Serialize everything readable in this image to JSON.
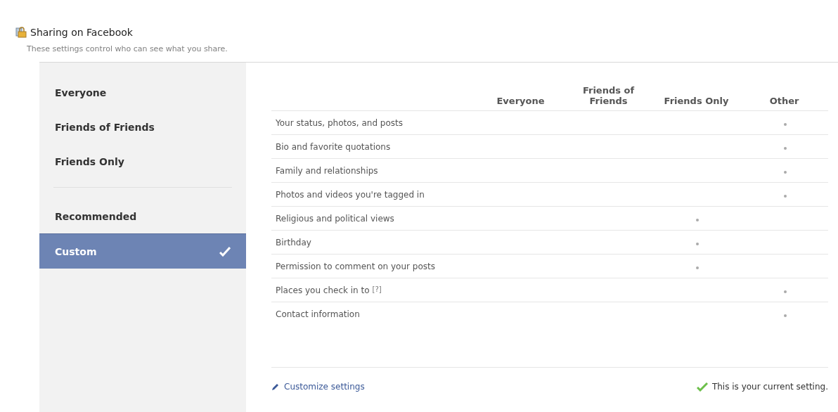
{
  "header": {
    "title": "Sharing on Facebook",
    "subtitle": "These settings control who can see what you share."
  },
  "sidebar": {
    "groups": [
      {
        "items": [
          {
            "label": "Everyone",
            "selected": false
          },
          {
            "label": "Friends of Friends",
            "selected": false
          },
          {
            "label": "Friends Only",
            "selected": false
          }
        ]
      },
      {
        "items": [
          {
            "label": "Recommended",
            "selected": false
          },
          {
            "label": "Custom",
            "selected": true
          }
        ]
      }
    ]
  },
  "table": {
    "columns": [
      "",
      "Everyone",
      "Friends of\nFriends",
      "Friends Only",
      "Other"
    ],
    "rows": [
      {
        "label": "Your status, photos, and posts",
        "cells": [
          {
            "selected": false
          },
          {
            "selected": false
          },
          {
            "selected": false
          },
          {
            "selected": true
          }
        ]
      },
      {
        "label": "Bio and favorite quotations",
        "cells": [
          {
            "selected": false
          },
          {
            "selected": false
          },
          {
            "selected": false
          },
          {
            "selected": true
          }
        ]
      },
      {
        "label": "Family and relationships",
        "cells": [
          {
            "selected": false
          },
          {
            "selected": false
          },
          {
            "selected": false
          },
          {
            "selected": true
          }
        ]
      },
      {
        "label": "Photos and videos you're tagged in",
        "cells": [
          {
            "selected": false
          },
          {
            "selected": false
          },
          {
            "selected": false
          },
          {
            "selected": true
          }
        ]
      },
      {
        "label": "Religious and political views",
        "cells": [
          {
            "selected": false
          },
          {
            "selected": false
          },
          {
            "selected": true
          },
          {
            "selected": false
          }
        ]
      },
      {
        "label": "Birthday",
        "cells": [
          {
            "selected": false
          },
          {
            "selected": false
          },
          {
            "selected": true
          },
          {
            "selected": false
          }
        ]
      },
      {
        "label": "Permission to comment on your posts",
        "cells": [
          {
            "selected": false
          },
          {
            "selected": false
          },
          {
            "selected": true
          },
          {
            "selected": false
          }
        ]
      },
      {
        "label": "Places you check in to",
        "help": "[?]",
        "cells": [
          {
            "selected": false
          },
          {
            "selected": false
          },
          {
            "selected": false
          },
          {
            "selected": true
          }
        ]
      },
      {
        "label": "Contact information",
        "cells": [
          {
            "selected": false
          },
          {
            "selected": false
          },
          {
            "selected": false
          },
          {
            "selected": true
          }
        ]
      }
    ]
  },
  "footer": {
    "link": "Customize settings",
    "status": "This is your current setting."
  }
}
